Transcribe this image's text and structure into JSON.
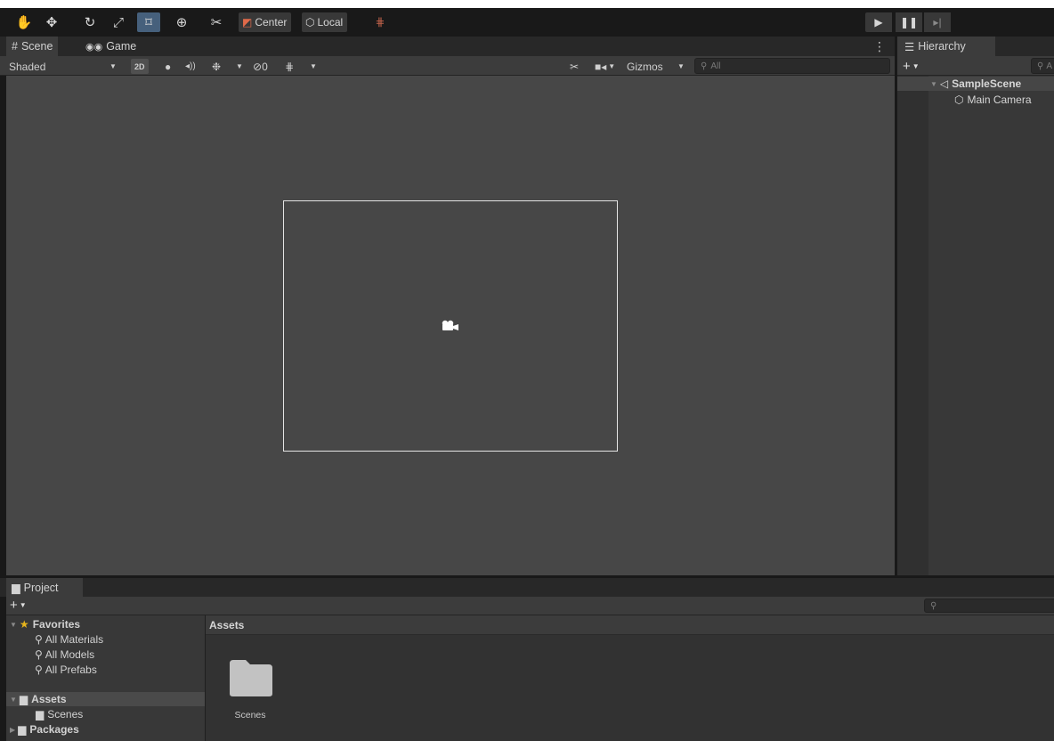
{
  "toolbar": {
    "tools": [
      "hand-tool",
      "move-tool",
      "rotate-tool",
      "scale-tool",
      "rect-tool",
      "transform-tool",
      "custom-tool"
    ],
    "pivot_label": "Center",
    "space_label": "Local"
  },
  "scene_tabs": {
    "scene_label": "Scene",
    "game_label": "Game"
  },
  "scene_toolbar": {
    "shading_mode": "Shaded",
    "mode_2d_label": "2D",
    "hidden_count": "0",
    "gizmos_label": "Gizmos",
    "search_placeholder": "All"
  },
  "hierarchy": {
    "tab_label": "Hierarchy",
    "search_placeholder": "A",
    "scene_name": "SampleScene",
    "items": [
      "Main Camera"
    ]
  },
  "project": {
    "tab_label": "Project",
    "favorites_label": "Favorites",
    "favorites": [
      "All Materials",
      "All Models",
      "All Prefabs"
    ],
    "assets_label": "Assets",
    "asset_folders": [
      "Scenes"
    ],
    "packages_label": "Packages",
    "breadcrumb": "Assets",
    "content_items": [
      "Scenes"
    ]
  },
  "colors": {
    "accent_selected": "#46607c",
    "viewport_bg": "#474747",
    "panel_bg": "#383838"
  }
}
